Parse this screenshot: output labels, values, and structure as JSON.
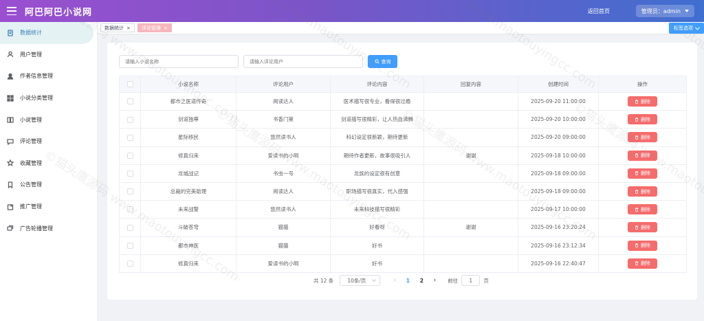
{
  "header": {
    "brand": "阿巴阿巴小说网",
    "home_link": "返回首页",
    "admin_label": "管理员：admin"
  },
  "sidebar": {
    "items": [
      {
        "label": "数据统计",
        "icon": "document-icon",
        "active": true
      },
      {
        "label": "用户管理",
        "icon": "user-icon"
      },
      {
        "label": "作者信息管理",
        "icon": "person-filled-icon"
      },
      {
        "label": "小说分类管理",
        "icon": "grid-icon"
      },
      {
        "label": "小说管理",
        "icon": "book-icon"
      },
      {
        "label": "评论管理",
        "icon": "comment-icon"
      },
      {
        "label": "收藏管理",
        "icon": "star-icon"
      },
      {
        "label": "公告管理",
        "icon": "bookmark-icon"
      },
      {
        "label": "推广管理",
        "icon": "promo-icon"
      },
      {
        "label": "广告轮播管理",
        "icon": "carousel-icon"
      }
    ]
  },
  "tags": [
    {
      "label": "数据统计",
      "active": false
    },
    {
      "label": "评论管理",
      "active": true
    }
  ],
  "tag_options_label": "标签选项",
  "search": {
    "novel_placeholder": "请输入小说名称",
    "user_placeholder": "请输入评论用户",
    "button_label": "查询"
  },
  "table": {
    "headers": [
      "小说名称",
      "评论用户",
      "评论内容",
      "回复内容",
      "创建时间",
      "操作"
    ],
    "delete_label": "删除",
    "rows": [
      [
        "都市之医道传奇",
        "阅读达人",
        "医术描写很专业，看得很过瘾",
        "",
        "2025-09-20 11:00:00"
      ],
      [
        "剑道独尊",
        "书香门第",
        "剑道描写很精彩，让人热血沸腾",
        "",
        "2025-09-20 10:00:00"
      ],
      [
        "星际移民",
        "悠然读书人",
        "科幻设定很新颖，期待更新",
        "",
        "2025-09-20 09:00:00"
      ],
      [
        "修真归来",
        "爱读书的小明",
        "期待作者更新，故事很吸引人",
        "谢谢",
        "2025-09-18 10:00:00"
      ],
      [
        "龙城战记",
        "书虫一号",
        "龙族的设定很有创意",
        "",
        "2025-09-18 09:00:00"
      ],
      [
        "总裁的完美助理",
        "阅读达人",
        "职场描写很真实，代入感强",
        "",
        "2025-09-18 09:00:00"
      ],
      [
        "未来战警",
        "悠然读书人",
        "未来科技描写很精彩",
        "",
        "2025-09-17 10:00:00"
      ],
      [
        "斗破苍穹",
        "猫猫",
        "好看呀",
        "谢谢",
        "2025-09-16 23:20:24"
      ],
      [
        "都市神医",
        "猫猫",
        "好书",
        "",
        "2025-09-16 23:12:34"
      ],
      [
        "修真归来",
        "爱读书的小明",
        "好书",
        "",
        "2025-09-16 22:40:47"
      ]
    ]
  },
  "pagination": {
    "total": "共 12 条",
    "page_size": "10条/页",
    "pages": [
      "1",
      "2"
    ],
    "current_page": "1",
    "goto_label": "前往",
    "goto_value": "1",
    "page_unit": "页"
  },
  "watermark": "©猫头鹰源码 www.maotouyingcc.com"
}
